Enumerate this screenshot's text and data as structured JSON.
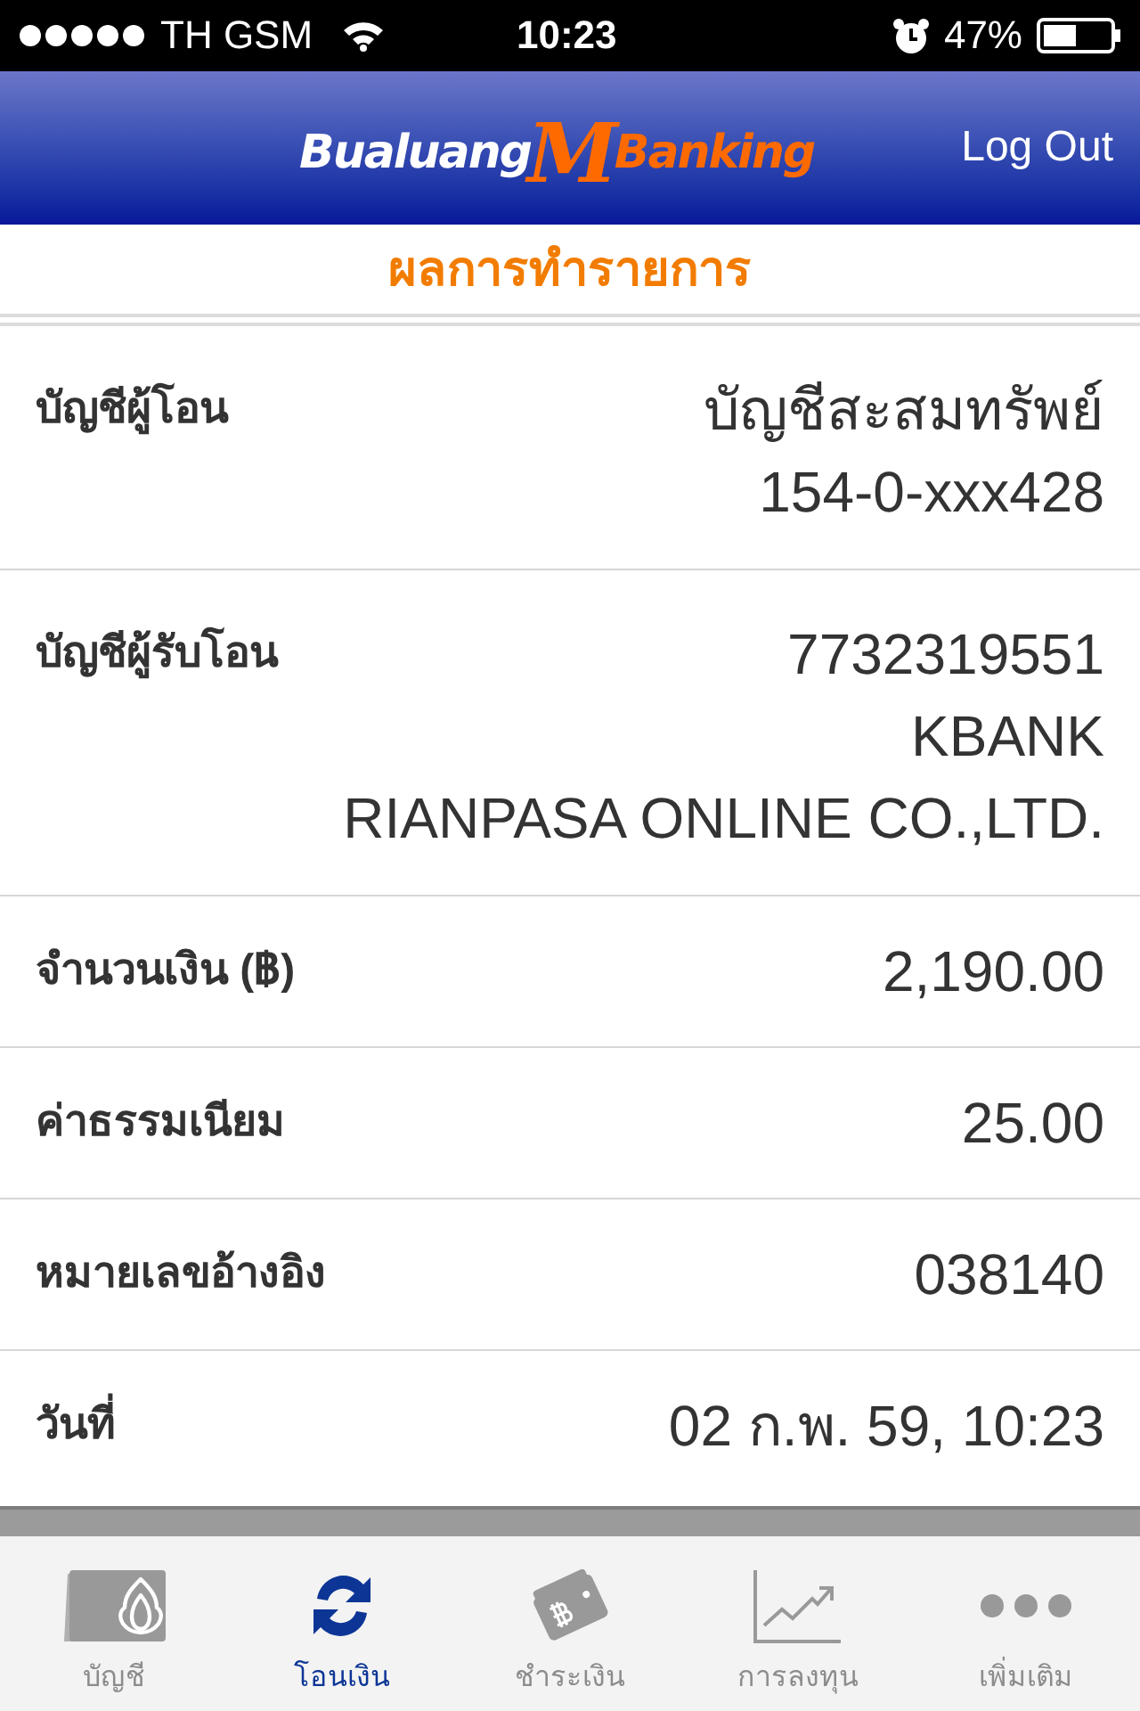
{
  "status_bar": {
    "carrier": "TH GSM",
    "time": "10:23",
    "battery": "47%"
  },
  "header": {
    "logo": {
      "left": "Bualuang",
      "mark": "M",
      "right": "Banking"
    },
    "action": "Log Out"
  },
  "title": "ผลการทำรายการ",
  "rows": [
    {
      "label": "บัญชีผู้โอน",
      "values": [
        "บัญชีสะสมทรัพย์",
        "154-0-xxx428"
      ]
    },
    {
      "label": "บัญชีผู้รับโอน",
      "values": [
        "7732319551",
        "KBANK",
        "RIANPASA ONLINE CO.,LTD."
      ]
    },
    {
      "label": "จำนวนเงิน (฿)",
      "values": [
        "2,190.00"
      ]
    },
    {
      "label": "ค่าธรรมเนียม",
      "values": [
        "25.00"
      ]
    },
    {
      "label": "หมายเลขอ้างอิง",
      "values": [
        "038140"
      ]
    },
    {
      "label": "วันที่",
      "values": [
        "02 ก.พ. 59, 10:23"
      ]
    }
  ],
  "tabs": [
    {
      "label": "บัญชี",
      "selected": false
    },
    {
      "label": "โอนเงิน",
      "selected": true
    },
    {
      "label": "ชำระเงิน",
      "selected": false
    },
    {
      "label": "การลงทุน",
      "selected": false
    },
    {
      "label": "เพิ่มเติม",
      "selected": false
    }
  ]
}
